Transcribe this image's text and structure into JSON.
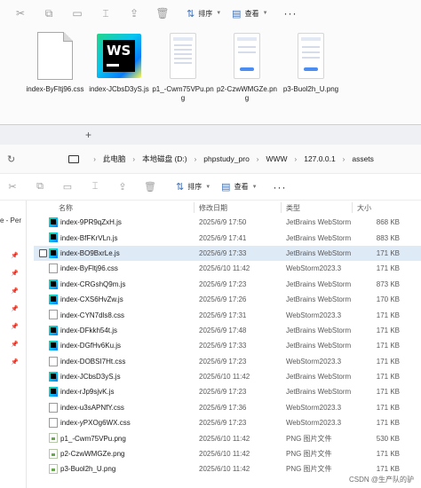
{
  "top_window": {
    "toolbar": {
      "sort_label": "排序",
      "view_label": "查看",
      "more_label": "···"
    },
    "files": [
      {
        "name": "index-ByFltj96.css",
        "icon": "generic-file-icon"
      },
      {
        "name": "index-JCbsD3yS.js",
        "icon": "webstorm-icon"
      },
      {
        "name": "p1_-Cwm75VPu.png",
        "icon": "png-thumbnail"
      },
      {
        "name": "p2-CzwWMGZe.png",
        "icon": "png-thumbnail"
      },
      {
        "name": "p3-Buol2h_U.png",
        "icon": "png-thumbnail"
      }
    ]
  },
  "front_window": {
    "new_tab": "+",
    "breadcrumb": [
      "此电脑",
      "本地磁盘 (D:)",
      "phpstudy_pro",
      "WWW",
      "127.0.0.1",
      "assets"
    ],
    "toolbar": {
      "sort_label": "排序",
      "view_label": "查看",
      "more_label": "···"
    },
    "nav_label": "e - Per",
    "columns": {
      "name": "名称",
      "date": "修改日期",
      "type": "类型",
      "size": "大小"
    },
    "rows": [
      {
        "name": "index-9PR9qZxH.js",
        "date": "2025/6/9 17:50",
        "type": "JetBrains WebStorm",
        "size": "868 KB",
        "icon": "webstorm-icon",
        "selected": false
      },
      {
        "name": "index-BfFKrVLn.js",
        "date": "2025/6/9 17:41",
        "type": "JetBrains WebStorm",
        "size": "883 KB",
        "icon": "webstorm-icon",
        "selected": false
      },
      {
        "name": "index-BO9BxrLe.js",
        "date": "2025/6/9 17:33",
        "type": "JetBrains WebStorm",
        "size": "171 KB",
        "icon": "webstorm-icon",
        "selected": true
      },
      {
        "name": "index-ByFltj96.css",
        "date": "2025/6/10 11:42",
        "type": "WebStorm2023.3",
        "size": "171 KB",
        "icon": "css-file-icon",
        "selected": false
      },
      {
        "name": "index-CRGshQ9m.js",
        "date": "2025/6/9 17:23",
        "type": "JetBrains WebStorm",
        "size": "873 KB",
        "icon": "webstorm-icon",
        "selected": false
      },
      {
        "name": "index-CXS6HvZw.js",
        "date": "2025/6/9 17:26",
        "type": "JetBrains WebStorm",
        "size": "170 KB",
        "icon": "webstorm-icon",
        "selected": false
      },
      {
        "name": "index-CYN7dls8.css",
        "date": "2025/6/9 17:31",
        "type": "WebStorm2023.3",
        "size": "171 KB",
        "icon": "css-file-icon",
        "selected": false
      },
      {
        "name": "index-DFkkh54t.js",
        "date": "2025/6/9 17:48",
        "type": "JetBrains WebStorm",
        "size": "171 KB",
        "icon": "webstorm-icon",
        "selected": false
      },
      {
        "name": "index-DGfHv6Ku.js",
        "date": "2025/6/9 17:33",
        "type": "JetBrains WebStorm",
        "size": "171 KB",
        "icon": "webstorm-icon",
        "selected": false
      },
      {
        "name": "index-DOBSI7Ht.css",
        "date": "2025/6/9 17:23",
        "type": "WebStorm2023.3",
        "size": "171 KB",
        "icon": "css-file-icon",
        "selected": false
      },
      {
        "name": "index-JCbsD3yS.js",
        "date": "2025/6/10 11:42",
        "type": "JetBrains WebStorm",
        "size": "171 KB",
        "icon": "webstorm-icon",
        "selected": false
      },
      {
        "name": "index-rJp9sjvK.js",
        "date": "2025/6/9 17:23",
        "type": "JetBrains WebStorm",
        "size": "171 KB",
        "icon": "webstorm-icon",
        "selected": false
      },
      {
        "name": "index-u3sAPNfY.css",
        "date": "2025/6/9 17:36",
        "type": "WebStorm2023.3",
        "size": "171 KB",
        "icon": "css-file-icon",
        "selected": false
      },
      {
        "name": "index-yPXOg6WX.css",
        "date": "2025/6/9 17:23",
        "type": "WebStorm2023.3",
        "size": "171 KB",
        "icon": "css-file-icon",
        "selected": false
      },
      {
        "name": "p1_-Cwm75VPu.png",
        "date": "2025/6/10 11:42",
        "type": "PNG 图片文件",
        "size": "530 KB",
        "icon": "png-file-icon",
        "selected": false
      },
      {
        "name": "p2-CzwWMGZe.png",
        "date": "2025/6/10 11:42",
        "type": "PNG 图片文件",
        "size": "171 KB",
        "icon": "png-file-icon",
        "selected": false
      },
      {
        "name": "p3-Buol2h_U.png",
        "date": "2025/6/10 11:42",
        "type": "PNG 图片文件",
        "size": "171 KB",
        "icon": "png-file-icon",
        "selected": false
      }
    ]
  },
  "watermark": "CSDN @生产队的驴",
  "colors": {
    "selection": "#dfeaf7",
    "accent": "#3b6fb6"
  }
}
